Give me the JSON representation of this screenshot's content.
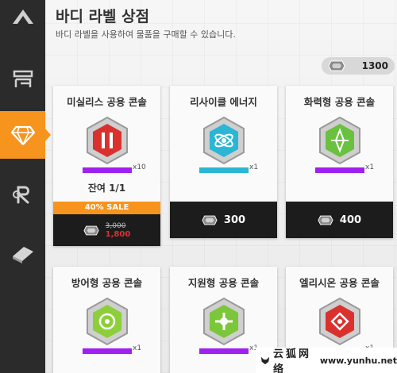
{
  "header": {
    "title": "바디 라벨 상점",
    "subtitle": "바디 라벨을 사용하여 물품을 구매할 수 있습니다."
  },
  "currency": {
    "icon": "crystal-chip-icon",
    "value": "1300"
  },
  "sidebar": {
    "items": [
      {
        "icon": "camp-icon",
        "active": false
      },
      {
        "icon": "shelf-icon",
        "active": false
      },
      {
        "icon": "diamond-icon",
        "active": true
      },
      {
        "icon": "r-logo-icon",
        "active": false
      },
      {
        "icon": "block-icon",
        "active": false
      }
    ]
  },
  "shop": {
    "items": [
      {
        "name": "미실리스 공용 콘솔",
        "qty": "x10",
        "remain": "잔여 1/1",
        "sale": "40% SALE",
        "old_price": "3,000",
        "price": "1,800",
        "color": "#d9322e",
        "bar": "#a020f0"
      },
      {
        "name": "리사이클 에너지",
        "qty": "x1",
        "price": "300",
        "color": "#2bb6d6",
        "bar": "#2bb6d6"
      },
      {
        "name": "화력형 공용 콘솔",
        "qty": "x1",
        "price": "400",
        "color": "#6ac13f",
        "bar": "#a020f0"
      },
      {
        "name": "방어형 공용 콘솔",
        "qty": "x1",
        "color": "#8ccf3a",
        "bar": "#a020f0"
      },
      {
        "name": "지원형 공용 콘솔",
        "qty": "x1",
        "color": "#7cc63a",
        "bar": "#a020f0"
      },
      {
        "name": "엘리시온 공용 콘솔",
        "qty": "x1",
        "color": "#d9322e",
        "bar": "#a020f0"
      }
    ]
  },
  "watermark": {
    "cn": "云狐网络",
    "url": "www.yunhu.net"
  }
}
